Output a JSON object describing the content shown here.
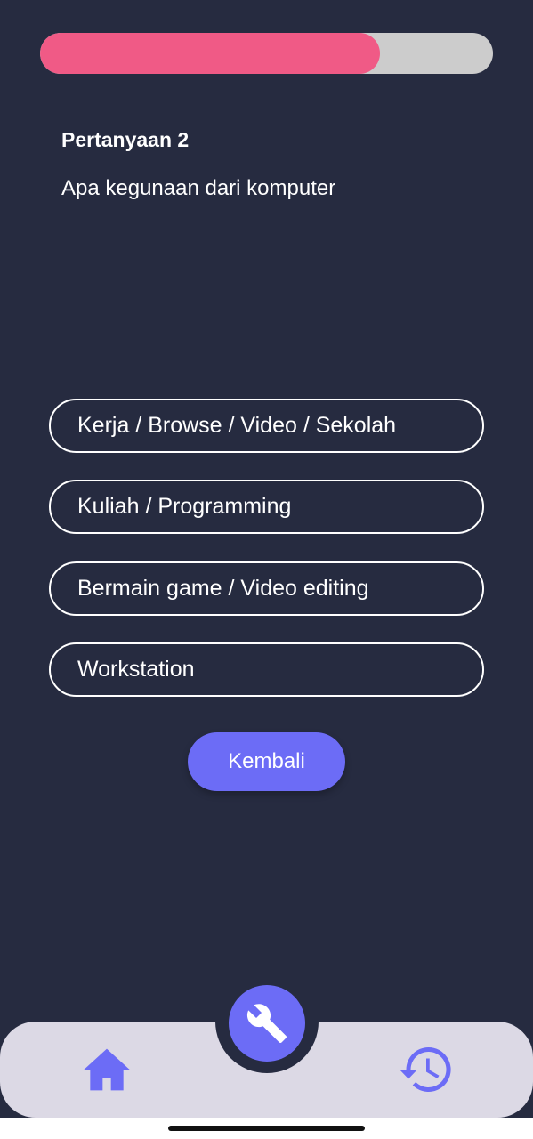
{
  "progress": {
    "fraction": 0.75,
    "fill_color": "#f05a86",
    "track_color": "#cccccc"
  },
  "question": {
    "number_label": "Pertanyaan 2",
    "text": "Apa kegunaan dari komputer"
  },
  "options": [
    {
      "label": "Kerja / Browse / Video / Sekolah"
    },
    {
      "label": "Kuliah / Programming"
    },
    {
      "label": "Bermain game / Video editing"
    },
    {
      "label": "Workstation"
    }
  ],
  "back_button": {
    "label": "Kembali"
  },
  "bottom_nav": {
    "items": [
      {
        "icon": "home-icon"
      },
      {
        "icon": "wrench-icon"
      },
      {
        "icon": "history-icon"
      }
    ],
    "accent_color": "#6c6cf6",
    "background_color": "#dcd9e5"
  },
  "theme": {
    "background": "#262b40"
  }
}
